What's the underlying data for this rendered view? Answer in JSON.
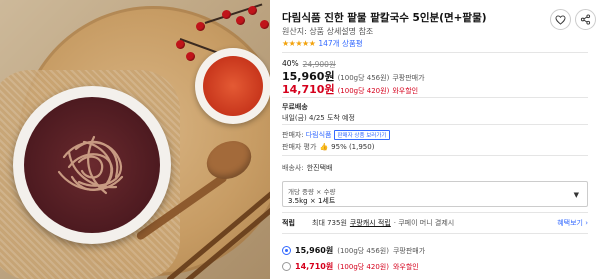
{
  "product": {
    "title": "다림식품 진한 팥물 팥칼국수 5인분(면+팥물)",
    "origin": "원산지: 상품 상세설명 참조",
    "stars": "★★★★★",
    "review_count": "147개 상품평",
    "rating_value": 5
  },
  "price": {
    "discount_rate": "40%",
    "original_price": "24,900원",
    "sale_price": "15,960원",
    "sale_unit": "(100g당 456원)",
    "sale_tag": "쿠팡판매가",
    "member_price": "14,710원",
    "member_unit": "(100g당 420원)",
    "member_tag": "와우할인"
  },
  "shipping": {
    "title": "무료배송",
    "arrival": "내일(금) 4/25 도착 예정"
  },
  "seller": {
    "label": "판매자:",
    "name": "다림식품",
    "badge": "판매자 상품 보러가기",
    "rating_label": "판매자 평가",
    "rating_value": "95% (1,950)"
  },
  "delivery": {
    "label": "배송사:",
    "carrier": "한진택배"
  },
  "option": {
    "header": "개당 중량 × 수량",
    "value": "3.5kg × 1세트",
    "caret": "▼"
  },
  "reward": {
    "label": "적립",
    "text": "최대 735원",
    "link": "쿠팡캐시 적립",
    "suffix": "· 쿠페이 머니 결제시",
    "more": "혜택보기 ›"
  },
  "options": [
    {
      "price": "15,960원",
      "unit": "(100g당 456원)",
      "tag": "쿠팡판매가",
      "selected": true
    },
    {
      "price": "14,710원",
      "unit": "(100g당 420원)",
      "tag": "와우할인",
      "selected": false
    }
  ],
  "colors": {
    "accent_red": "#d5001c",
    "link_blue": "#346aff",
    "star_orange": "#f2a20c"
  }
}
